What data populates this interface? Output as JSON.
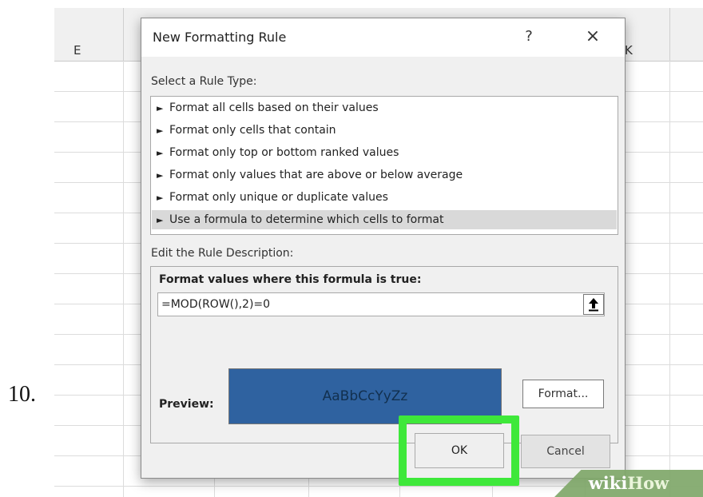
{
  "step_number": "10.",
  "spreadsheet": {
    "column_letters": [
      "E",
      "K"
    ]
  },
  "dialog": {
    "title": "New Formatting Rule",
    "help_glyph": "?",
    "close_glyph": "×",
    "select_rule_type_label": "Select a Rule Type:",
    "rule_types": [
      {
        "label": "Format all cells based on their values",
        "selected": false
      },
      {
        "label": "Format only cells that contain",
        "selected": false
      },
      {
        "label": "Format only top or bottom ranked values",
        "selected": false
      },
      {
        "label": "Format only values that are above or below average",
        "selected": false
      },
      {
        "label": "Format only unique or duplicate values",
        "selected": false
      },
      {
        "label": "Use a formula to determine which cells to format",
        "selected": true
      }
    ],
    "rule_arrow_glyph": "►",
    "edit_description_label": "Edit the Rule Description:",
    "formula_heading": "Format values where this formula is true:",
    "formula_value": "=MOD(ROW(),2)=0",
    "collapse_icon": "upload-arrow-icon",
    "preview_label": "Preview:",
    "preview_sample": "AaBbCcYyZz",
    "preview_fill_color": "#2f62a0",
    "format_button": "Format...",
    "ok_button": "OK",
    "cancel_button": "Cancel",
    "highlight_color": "#3ee83a"
  },
  "watermark": {
    "part1": "wiki",
    "part2": "How"
  }
}
